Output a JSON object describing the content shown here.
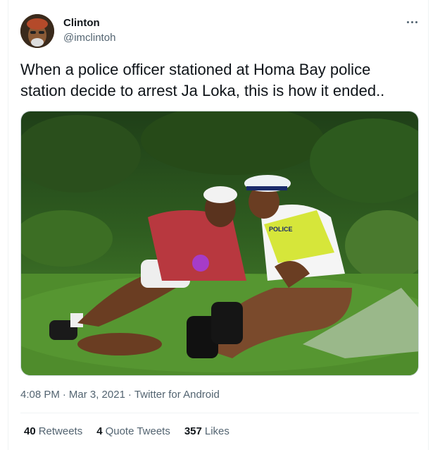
{
  "user": {
    "name": "Clinton",
    "handle": "@imclintoh"
  },
  "tweet": {
    "text": "When a police officer stationed at Homa Bay police station decide to arrest Ja Loka, this is how it ended.."
  },
  "photo": {
    "vest_text": "POLICE"
  },
  "meta": {
    "time": "4:08 PM",
    "separator1": "·",
    "date": "Mar 3, 2021",
    "separator2": "·",
    "source": "Twitter for Android"
  },
  "stats": {
    "retweets_count": "40",
    "retweets_label": "Retweets",
    "quotes_count": "4",
    "quotes_label": "Quote Tweets",
    "likes_count": "357",
    "likes_label": "Likes"
  },
  "colors": {
    "text_primary": "#0f1419",
    "text_secondary": "#536471",
    "border": "#eff3f4",
    "grass": "#3f7a28"
  },
  "icons": {
    "more": "more-horizontal-icon"
  }
}
